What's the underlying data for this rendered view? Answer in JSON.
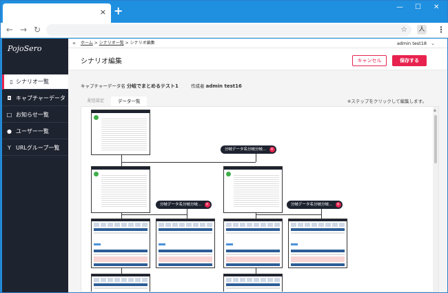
{
  "browser": {
    "tab_close": "×",
    "new_tab": "+",
    "win_min": "—",
    "win_max": "☐",
    "win_close": "✕",
    "back": "←",
    "forward": "→",
    "reload": "↻",
    "star": "☆",
    "ext": "人",
    "menu": "⋮"
  },
  "sidebar": {
    "logo": "PojoSero",
    "items": [
      {
        "label": "シナリオ一覧",
        "icon": "▯"
      },
      {
        "label": "キャプチャーデータ",
        "icon": "◘"
      },
      {
        "label": "お知らせ一覧",
        "icon": "□"
      },
      {
        "label": "ユーザー一覧",
        "icon": "●"
      },
      {
        "label": "URLグループ一覧",
        "icon": "Y"
      }
    ]
  },
  "topbar": {
    "collapse": "«",
    "crumb_home": "ホーム",
    "crumb_sep": ">",
    "crumb_list": "シナリオ一覧",
    "crumb_current": "シナリオ編集",
    "user": "admin test18",
    "caret": "⌄"
  },
  "header": {
    "title": "シナリオ編集",
    "cancel": "キャンセル",
    "save": "保存する"
  },
  "meta": {
    "capture_label": "キャプチャーデータ名",
    "capture_value": "分岐でまとめるテスト1",
    "author_label": "作成者",
    "author_value": "admin test16"
  },
  "tabs": {
    "delivery": "配信設定",
    "data_list": "データ一覧",
    "hint": "※ステップをクリックして編集します。"
  },
  "branches": [
    {
      "label": "分岐データ名分岐分岐…"
    },
    {
      "label": "分岐データ名分岐分岐…"
    },
    {
      "label": "分岐データ名分岐分岐…"
    }
  ],
  "branch_remove": "×",
  "colors": {
    "accent": "#e8224e",
    "sidebar": "#1e2330",
    "browser_chrome": "#1f8fe0"
  }
}
